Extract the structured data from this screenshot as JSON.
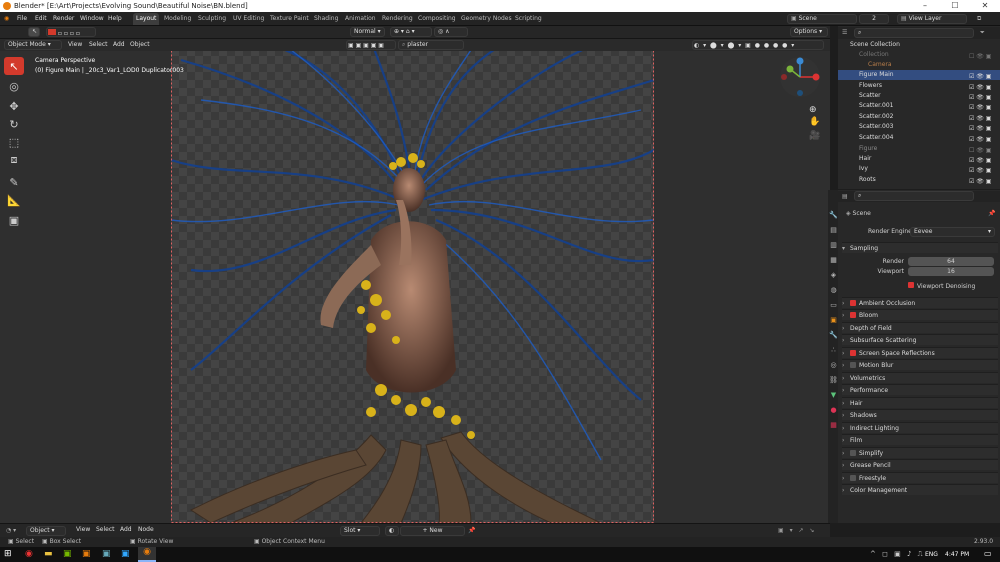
{
  "window": {
    "title": "Blender* [E:\\Art\\Projects\\Evolving Sound\\Beautiful Noise\\BN.blend]"
  },
  "menu": [
    "File",
    "Edit",
    "Render",
    "Window",
    "Help"
  ],
  "workspaces": [
    "Layout",
    "Modeling",
    "Sculpting",
    "UV Editing",
    "Texture Paint",
    "Shading",
    "Animation",
    "Rendering",
    "Compositing",
    "Geometry Nodes",
    "Scripting"
  ],
  "active_workspace": "Layout",
  "scene": {
    "name": "Scene",
    "count": "2",
    "view_layer": "View Layer"
  },
  "header3d": {
    "mode": "Object Mode",
    "view": "View",
    "select": "Select",
    "add": "Add",
    "object": "Object",
    "orientation": "Normal",
    "search_value": "plaster",
    "options": "Options"
  },
  "viewport": {
    "camera_label": "Camera Perspective",
    "object_label": "(0) Figure Main | _20c3_Var1_LOD0 Duplicator003"
  },
  "outliner": {
    "root": "Scene Collection",
    "items": [
      {
        "name": "Collection",
        "dim": true
      },
      {
        "name": "Camera",
        "dim": true
      },
      {
        "name": "Figure Main",
        "selected": true
      },
      {
        "name": "Flowers"
      },
      {
        "name": "Scatter"
      },
      {
        "name": "Scatter.001"
      },
      {
        "name": "Scatter.002"
      },
      {
        "name": "Scatter.003"
      },
      {
        "name": "Scatter.004"
      },
      {
        "name": "Figure",
        "dim": true
      },
      {
        "name": "Hair"
      },
      {
        "name": "Ivy"
      },
      {
        "name": "Roots"
      }
    ]
  },
  "properties": {
    "scene_label": "Scene",
    "render_engine_label": "Render Engine",
    "render_engine": "Eevee",
    "sampling": {
      "title": "Sampling",
      "render_label": "Render",
      "render": "64",
      "viewport_label": "Viewport",
      "viewport": "16",
      "denoise": "Viewport Denoising"
    },
    "panels": [
      {
        "label": "Ambient Occlusion",
        "checkbox": true
      },
      {
        "label": "Bloom",
        "checkbox": true
      },
      {
        "label": "Depth of Field"
      },
      {
        "label": "Subsurface Scattering"
      },
      {
        "label": "Screen Space Reflections",
        "checkbox": true
      },
      {
        "label": "Motion Blur",
        "checkbox": false
      },
      {
        "label": "Volumetrics"
      },
      {
        "label": "Performance"
      },
      {
        "label": "Hair"
      },
      {
        "label": "Shadows"
      },
      {
        "label": "Indirect Lighting"
      },
      {
        "label": "Film"
      },
      {
        "label": "Simplify",
        "checkbox": false
      },
      {
        "label": "Grease Pencil"
      },
      {
        "label": "Freestyle",
        "checkbox": false
      },
      {
        "label": "Color Management"
      }
    ]
  },
  "bottom_header": {
    "mode": "Object",
    "view": "View",
    "select": "Select",
    "add": "Add",
    "node": "Node",
    "slot": "Slot",
    "new": "New"
  },
  "status": {
    "select": "Select",
    "box_select": "Box Select",
    "rotate_view": "Rotate View",
    "context_menu": "Object Context Menu",
    "version": "2.93.0"
  },
  "taskbar": {
    "lang": "ENG",
    "time": "4:47 PM"
  },
  "colors": {
    "accent": "#334d80",
    "active_tool": "#d33a2c",
    "hair": "#1a4d9e",
    "flowers": "#d8b21a",
    "roots": "#5a4634"
  }
}
